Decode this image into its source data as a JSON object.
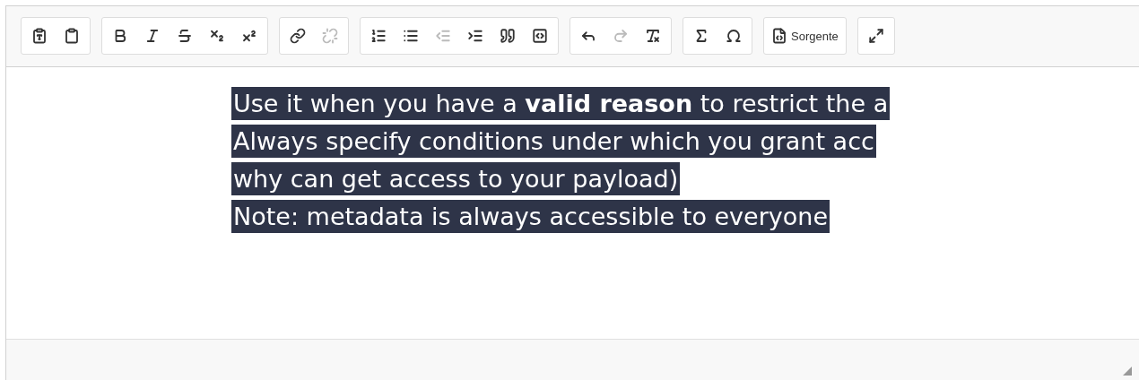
{
  "toolbar": {
    "groups": [
      {
        "buttons": [
          {
            "kind": "paste-text",
            "disabled": false
          },
          {
            "kind": "paste-word",
            "disabled": false
          }
        ]
      },
      {
        "buttons": [
          {
            "kind": "bold",
            "disabled": false
          },
          {
            "kind": "italic",
            "disabled": false
          },
          {
            "kind": "strike",
            "disabled": false
          },
          {
            "kind": "subscript",
            "disabled": false
          },
          {
            "kind": "superscript",
            "disabled": false
          }
        ]
      },
      {
        "buttons": [
          {
            "kind": "link",
            "disabled": false
          },
          {
            "kind": "unlink",
            "disabled": true
          }
        ]
      },
      {
        "buttons": [
          {
            "kind": "numbered-list",
            "disabled": false
          },
          {
            "kind": "bulleted-list",
            "disabled": false
          },
          {
            "kind": "outdent",
            "disabled": true
          },
          {
            "kind": "indent",
            "disabled": false
          },
          {
            "kind": "blockquote",
            "disabled": false
          },
          {
            "kind": "div",
            "disabled": false
          }
        ]
      },
      {
        "buttons": [
          {
            "kind": "undo",
            "disabled": false
          },
          {
            "kind": "redo",
            "disabled": true
          },
          {
            "kind": "remove-format",
            "disabled": false
          }
        ]
      },
      {
        "buttons": [
          {
            "kind": "sigma",
            "disabled": false
          },
          {
            "kind": "omega",
            "disabled": false
          }
        ]
      },
      {
        "buttons": [
          {
            "kind": "source",
            "disabled": false,
            "label": "Sorgente"
          }
        ]
      },
      {
        "buttons": [
          {
            "kind": "maximize",
            "disabled": false
          }
        ]
      }
    ]
  },
  "content": {
    "lines": [
      "Use it when you have a **valid reason** to restrict the a",
      "Always specify conditions under which you grant acc",
      "why can get access to your payload)",
      "Note: metadata is always accessible to everyone"
    ]
  }
}
